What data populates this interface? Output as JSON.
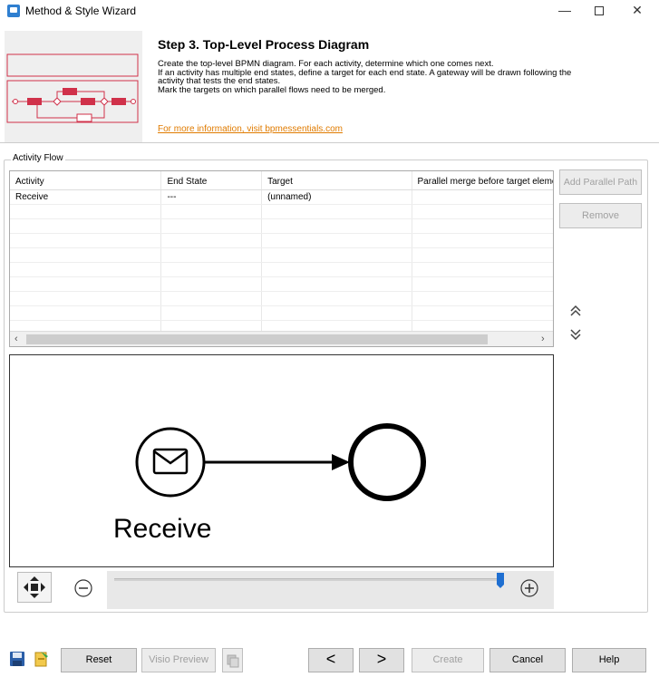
{
  "window": {
    "title": "Method & Style Wizard",
    "minimize": "—",
    "close": "✕"
  },
  "header": {
    "step_title": "Step 3. Top-Level Process Diagram",
    "desc_lines": [
      "Create the top-level BPMN diagram. For each activity, determine which one comes next.",
      "If an activity has multiple end states, define a target for each end state. A gateway will be drawn following the",
      "activity that tests the end states.",
      "Mark the targets on which parallel flows need to be merged."
    ],
    "link": "For more information, visit bpmessentials.com"
  },
  "activity_flow": {
    "label": "Activity Flow",
    "columns": [
      "Activity",
      "End State",
      "Target",
      "Parallel merge before target eleme"
    ],
    "rows": [
      [
        "Receive",
        "---",
        "(unnamed)",
        ""
      ]
    ],
    "empty_rows": 9
  },
  "side_buttons": {
    "add_parallel": "Add Parallel Path",
    "remove": "Remove",
    "move_up": "⌃",
    "move_down": "⌄"
  },
  "canvas": {
    "activity_label": "Receive"
  },
  "zoom": {
    "level_fraction": 0.99
  },
  "bottom": {
    "reset": "Reset",
    "visio_preview": "Visio Preview",
    "prev": "<",
    "next": ">",
    "create": "Create",
    "cancel": "Cancel",
    "help": "Help"
  },
  "colors": {
    "thumb_red": "#d0314a",
    "link_orange": "#e07b00",
    "slider_blue": "#1f6fd1"
  }
}
